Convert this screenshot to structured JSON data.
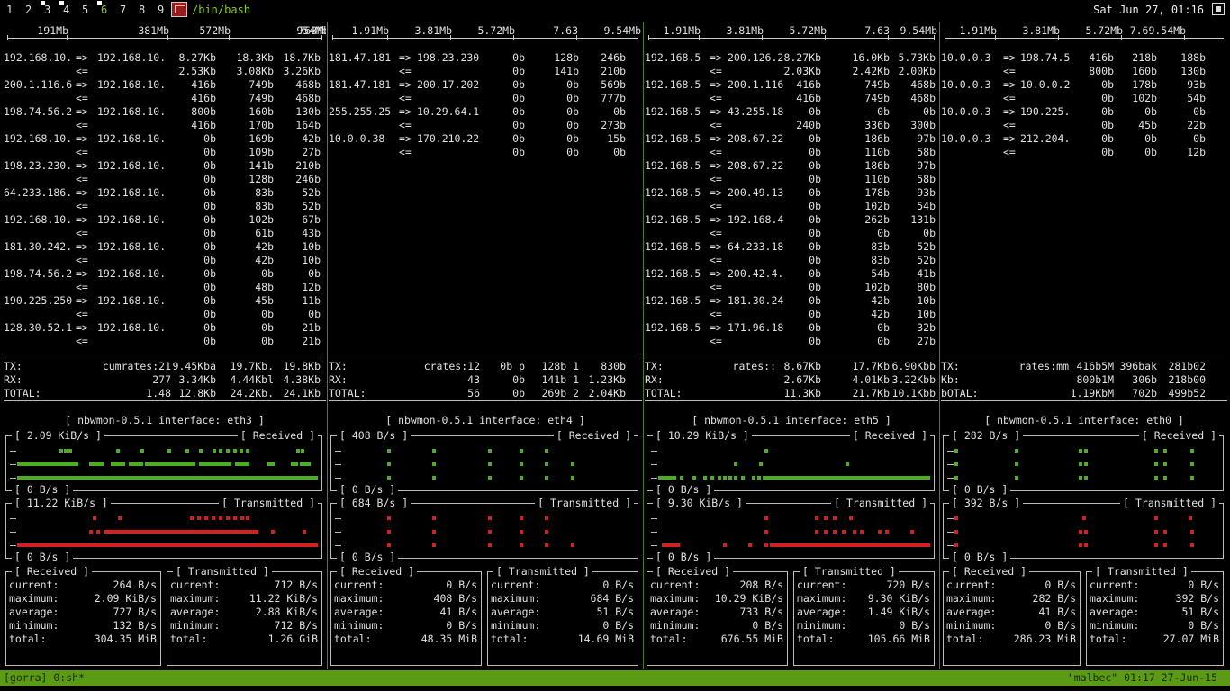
{
  "topbar": {
    "workspaces": [
      "1",
      "2",
      "3",
      "4",
      "5",
      "6",
      "7",
      "8",
      "9"
    ],
    "active_workspace": "6",
    "window_title": "/bin/bash",
    "clock": "Sat Jun 27, 01:16",
    "icons": [
      "terminal-icon",
      "tray-icon"
    ]
  },
  "panes": [
    {
      "name": "eth3",
      "scale": [
        "191Mb",
        "381Mb",
        "572Mb",
        "763Mb",
        "954Mb"
      ],
      "flows": [
        {
          "src": "192.168.10.",
          "dst": "192.168.10.",
          "tx": [
            "8.27Kb",
            "18.3Kb",
            "18.7Kb"
          ],
          "rx": [
            "2.53Kb",
            "3.08Kb",
            "3.26Kb"
          ]
        },
        {
          "src": "200.1.116.6",
          "dst": "192.168.10.",
          "tx": [
            "416b",
            "749b",
            "468b"
          ],
          "rx": [
            "416b",
            "749b",
            "468b"
          ]
        },
        {
          "src": "198.74.56.2",
          "dst": "192.168.10.",
          "tx": [
            "800b",
            "160b",
            "130b"
          ],
          "rx": [
            "416b",
            "170b",
            "164b"
          ]
        },
        {
          "src": "192.168.10.",
          "dst": "192.168.10.",
          "tx": [
            "0b",
            "169b",
            "42b"
          ],
          "rx": [
            "0b",
            "109b",
            "27b"
          ]
        },
        {
          "src": "198.23.230.",
          "dst": "192.168.10.",
          "tx": [
            "0b",
            "141b",
            "210b"
          ],
          "rx": [
            "0b",
            "128b",
            "246b"
          ]
        },
        {
          "src": "64.233.186.",
          "dst": "192.168.10.",
          "tx": [
            "0b",
            "83b",
            "52b"
          ],
          "rx": [
            "0b",
            "83b",
            "52b"
          ]
        },
        {
          "src": "192.168.10.",
          "dst": "192.168.10.",
          "tx": [
            "0b",
            "102b",
            "67b"
          ],
          "rx": [
            "0b",
            "61b",
            "43b"
          ]
        },
        {
          "src": "181.30.242.",
          "dst": "192.168.10.",
          "tx": [
            "0b",
            "42b",
            "10b"
          ],
          "rx": [
            "0b",
            "42b",
            "10b"
          ]
        },
        {
          "src": "198.74.56.2",
          "dst": "192.168.10.",
          "tx": [
            "0b",
            "0b",
            "0b"
          ],
          "rx": [
            "0b",
            "48b",
            "12b"
          ]
        },
        {
          "src": "190.225.250",
          "dst": "192.168.10.",
          "tx": [
            "0b",
            "45b",
            "11b"
          ],
          "rx": [
            "0b",
            "0b",
            "0b"
          ]
        },
        {
          "src": "128.30.52.1",
          "dst": "192.168.10.",
          "tx": [
            "0b",
            "0b",
            "21b"
          ],
          "rx": [
            "0b",
            "0b",
            "21b"
          ]
        }
      ],
      "totals": [
        {
          "label": "TX:",
          "mid": "cumrates:21",
          "vals": [
            "9.45Kba",
            "19.7Kb.",
            "19.8Kb"
          ]
        },
        {
          "label": "RX:",
          "mid": "277",
          "vals": [
            "3.34Kb",
            "4.44Kbl",
            "4.38Kb"
          ]
        },
        {
          "label": "TOTAL:",
          "mid": "1.48",
          "vals": [
            "12.8Kb",
            "24.2Kb.",
            "24.1Kb"
          ]
        }
      ],
      "nbwmon": {
        "title": "[ nbwmon-0.5.1 interface: eth3 ]",
        "rx_peak": "[ 2.09 KiB/s ]",
        "tx_peak": "[ 11.22 KiB/s ]",
        "rx_caption": "[ Received ]",
        "tx_caption": "[ Transmitted ]",
        "zero": "[ 0 B/s ]",
        "rx_stats": {
          "current": "264 B/s",
          "maximum": "2.09 KiB/s",
          "average": "727 B/s",
          "minimum": "132 B/s",
          "total": "304.35 MiB"
        },
        "tx_stats": {
          "current": "712 B/s",
          "maximum": "11.22 KiB/s",
          "average": "2.88 KiB/s",
          "minimum": "712 B/s",
          "total": "1.26 GiB"
        }
      }
    },
    {
      "name": "eth4",
      "scale": [
        "1.91Mb",
        "3.81Mb",
        "5.72Mb",
        "7.63",
        "9.54Mb"
      ],
      "flows": [
        {
          "src": "181.47.181",
          "dst": "198.23.230",
          "tx": [
            "0b",
            "128b",
            "246b"
          ],
          "rx": [
            "0b",
            "141b",
            "210b"
          ]
        },
        {
          "src": "181.47.181",
          "dst": "200.17.202",
          "tx": [
            "0b",
            "0b",
            "569b"
          ],
          "rx": [
            "0b",
            "0b",
            "777b"
          ]
        },
        {
          "src": "255.255.25",
          "dst": "10.29.64.1",
          "tx": [
            "0b",
            "0b",
            "0b"
          ],
          "rx": [
            "0b",
            "0b",
            "273b"
          ]
        },
        {
          "src": "10.0.0.38",
          "dst": "170.210.22",
          "tx": [
            "0b",
            "0b",
            "15b"
          ],
          "rx": [
            "0b",
            "0b",
            "0b"
          ]
        }
      ],
      "totals": [
        {
          "label": "TX:",
          "mid": "crates:12",
          "vals": [
            "0b p",
            "128b 1",
            "830b"
          ]
        },
        {
          "label": "RX:",
          "mid": "43",
          "vals": [
            "0b",
            "141b 1",
            "1.23Kb"
          ]
        },
        {
          "label": "TOTAL:",
          "mid": "56",
          "vals": [
            "0b",
            "269b 2",
            "2.04Kb"
          ]
        }
      ],
      "nbwmon": {
        "title": "[ nbwmon-0.5.1 interface: eth4 ]",
        "rx_peak": "[ 408 B/s ]",
        "tx_peak": "[ 684 B/s ]",
        "rx_caption": "[ Received ]",
        "tx_caption": "[ Transmitted ]",
        "zero": "[ 0 B/s ]",
        "rx_stats": {
          "current": "0 B/s",
          "maximum": "408 B/s",
          "average": "41 B/s",
          "minimum": "0 B/s",
          "total": "48.35 MiB"
        },
        "tx_stats": {
          "current": "0 B/s",
          "maximum": "684 B/s",
          "average": "51 B/s",
          "minimum": "0 B/s",
          "total": "14.69 MiB"
        }
      }
    },
    {
      "name": "eth5",
      "scale": [
        "1.91Mb",
        "3.81Mb",
        "5.72Mb",
        "7.63",
        "9.54Mb"
      ],
      "flows": [
        {
          "src": "192.168.5",
          "dst": "200.126.2",
          "tx": [
            "8.27Kb",
            "16.0Kb",
            "5.73Kb"
          ],
          "rx": [
            "2.03Kb",
            "2.42Kb",
            "2.00Kb"
          ]
        },
        {
          "src": "192.168.5",
          "dst": "200.1.116",
          "tx": [
            "416b",
            "749b",
            "468b"
          ],
          "rx": [
            "416b",
            "749b",
            "468b"
          ]
        },
        {
          "src": "192.168.5",
          "dst": "43.255.18",
          "tx": [
            "0b",
            "0b",
            "0b"
          ],
          "rx": [
            "240b",
            "336b",
            "300b"
          ]
        },
        {
          "src": "192.168.5",
          "dst": "208.67.22",
          "tx": [
            "0b",
            "186b",
            "97b"
          ],
          "rx": [
            "0b",
            "110b",
            "58b"
          ]
        },
        {
          "src": "192.168.5",
          "dst": "208.67.22",
          "tx": [
            "0b",
            "186b",
            "97b"
          ],
          "rx": [
            "0b",
            "110b",
            "58b"
          ]
        },
        {
          "src": "192.168.5",
          "dst": "200.49.13",
          "tx": [
            "0b",
            "178b",
            "93b"
          ],
          "rx": [
            "0b",
            "102b",
            "54b"
          ]
        },
        {
          "src": "192.168.5",
          "dst": "192.168.4",
          "tx": [
            "0b",
            "262b",
            "131b"
          ],
          "rx": [
            "0b",
            "0b",
            "0b"
          ]
        },
        {
          "src": "192.168.5",
          "dst": "64.233.18",
          "tx": [
            "0b",
            "83b",
            "52b"
          ],
          "rx": [
            "0b",
            "83b",
            "52b"
          ]
        },
        {
          "src": "192.168.5",
          "dst": "200.42.4.",
          "tx": [
            "0b",
            "54b",
            "41b"
          ],
          "rx": [
            "0b",
            "102b",
            "80b"
          ]
        },
        {
          "src": "192.168.5",
          "dst": "181.30.24",
          "tx": [
            "0b",
            "42b",
            "10b"
          ],
          "rx": [
            "0b",
            "42b",
            "10b"
          ]
        },
        {
          "src": "192.168.5",
          "dst": "171.96.18",
          "tx": [
            "0b",
            "0b",
            "32b"
          ],
          "rx": [
            "0b",
            "0b",
            "27b"
          ]
        }
      ],
      "totals": [
        {
          "label": "TX:",
          "mid": "rates::",
          "vals": [
            "8.67Kb",
            "17.7Kb",
            "6.90Kbb"
          ]
        },
        {
          "label": "RX:",
          "mid": "",
          "vals": [
            "2.67Kb",
            "4.01Kb",
            "3.22Kbb"
          ]
        },
        {
          "label": "TOTAL:",
          "mid": "",
          "vals": [
            "11.3Kb",
            "21.7Kb",
            "10.1Kbb"
          ]
        }
      ],
      "nbwmon": {
        "title": "[ nbwmon-0.5.1 interface: eth5 ]",
        "rx_peak": "[ 10.29 KiB/s ]",
        "tx_peak": "[ 9.30 KiB/s ]",
        "rx_caption": "[ Received ]",
        "tx_caption": "[ Transmitted ]",
        "zero": "[ 0 B/s ]",
        "rx_stats": {
          "current": "208 B/s",
          "maximum": "10.29 KiB/s",
          "average": "733 B/s",
          "minimum": "0 B/s",
          "total": "676.55 MiB"
        },
        "tx_stats": {
          "current": "720 B/s",
          "maximum": "9.30 KiB/s",
          "average": "1.49 KiB/s",
          "minimum": "0 B/s",
          "total": "105.66 MiB"
        }
      }
    },
    {
      "name": "eth0",
      "scale": [
        "1.91Mb",
        "3.81Mb",
        "5.72Mb",
        "7.69.54Mb"
      ],
      "flows": [
        {
          "src": "10.0.0.3",
          "dst": "198.74.5",
          "tx": [
            "416b",
            "218b",
            "188b"
          ],
          "rx": [
            "800b",
            "160b",
            "130b"
          ]
        },
        {
          "src": "10.0.0.3",
          "dst": "10.0.0.2",
          "tx": [
            "0b",
            "178b",
            "93b"
          ],
          "rx": [
            "0b",
            "102b",
            "54b"
          ]
        },
        {
          "src": "10.0.0.3",
          "dst": "190.225.",
          "tx": [
            "0b",
            "0b",
            "0b"
          ],
          "rx": [
            "0b",
            "45b",
            "22b"
          ]
        },
        {
          "src": "10.0.0.3",
          "dst": "212.204.",
          "tx": [
            "0b",
            "0b",
            "0b"
          ],
          "rx": [
            "0b",
            "0b",
            "12b"
          ]
        }
      ],
      "totals": [
        {
          "label": "TX:",
          "mid": "rates:mm",
          "vals": [
            "416b5M",
            "396bak",
            "281b02"
          ]
        },
        {
          "label": "Kb:",
          "mid": "",
          "vals": [
            "800b1M",
            "306b",
            "218b00"
          ]
        },
        {
          "label": "bOTAL:",
          "mid": "",
          "vals": [
            "1.19KbM",
            "702b",
            "499b52"
          ]
        }
      ],
      "nbwmon": {
        "title": "[ nbwmon-0.5.1 interface: eth0 ]",
        "rx_peak": "[ 282 B/s ]",
        "tx_peak": "[ 392 B/s ]",
        "rx_caption": "[ Received ]",
        "tx_caption": "[ Transmitted ]",
        "zero": "[ 0 B/s ]",
        "rx_stats": {
          "current": "0 B/s",
          "maximum": "282 B/s",
          "average": "41 B/s",
          "minimum": "0 B/s",
          "total": "286.23 MiB"
        },
        "tx_stats": {
          "current": "0 B/s",
          "maximum": "392 B/s",
          "average": "51 B/s",
          "minimum": "0 B/s",
          "total": "27.07 MiB"
        }
      }
    }
  ],
  "stat_labels": {
    "current": "current:",
    "maximum": "maximum:",
    "average": "average:",
    "minimum": "minimum:",
    "total": "total:"
  },
  "arrows": {
    "out": "=>",
    "in": "<="
  },
  "statusbar": {
    "left": "[gorra] 0:sh*",
    "right": "\"malbec\" 01:17 27-Jun-15"
  },
  "colors": {
    "rx_graph": "#4caf22",
    "tx_graph": "#d42020",
    "statusbar": "#5a9a14",
    "accent": "#8ac926"
  }
}
